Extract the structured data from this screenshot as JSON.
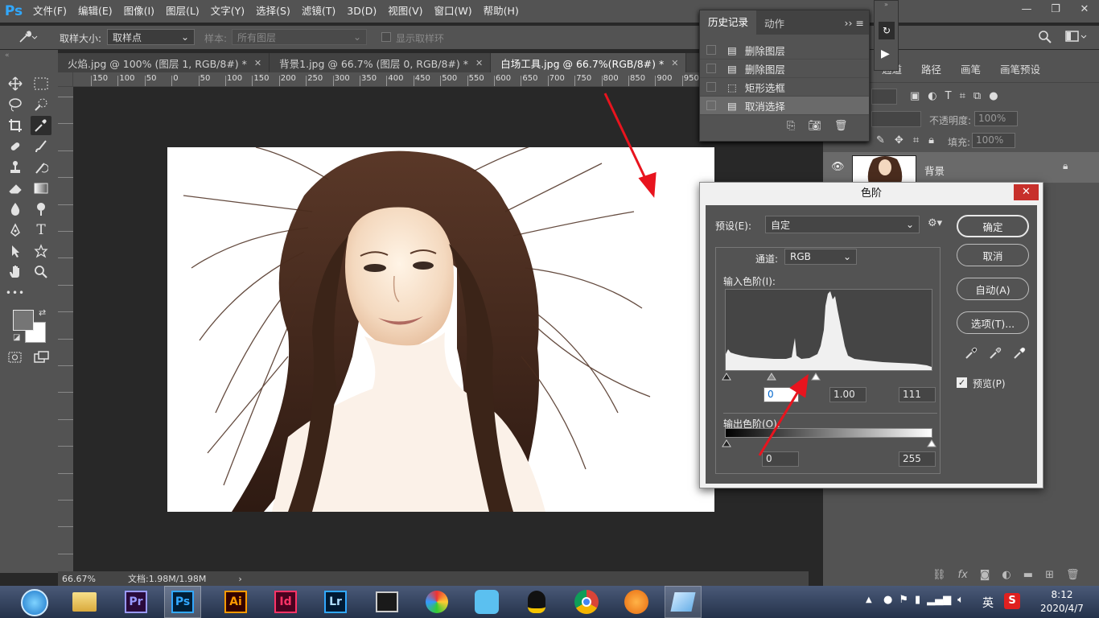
{
  "app": {
    "logo": "Ps"
  },
  "menu": [
    "文件(F)",
    "编辑(E)",
    "图像(I)",
    "图层(L)",
    "文字(Y)",
    "选择(S)",
    "滤镜(T)",
    "3D(D)",
    "视图(V)",
    "窗口(W)",
    "帮助(H)"
  ],
  "options_bar": {
    "sample_size_label": "取样大小:",
    "sample_size_value": "取样点",
    "sample_label": "样本:",
    "sample_value": "所有图层",
    "show_ring_label": "显示取样环"
  },
  "doc_tabs": [
    {
      "label": "火焰.jpg @ 100% (图层 1, RGB/8#) *"
    },
    {
      "label": "背景1.jpg @ 66.7% (图层 0, RGB/8#) *"
    },
    {
      "label": "白场工具.jpg @ 66.7%(RGB/8#) *"
    }
  ],
  "ruler_ticks": [
    "150",
    "100",
    "50",
    "0",
    "50",
    "100",
    "150",
    "200",
    "250",
    "300",
    "350",
    "400",
    "450",
    "500",
    "550",
    "600",
    "650",
    "700",
    "750",
    "800",
    "850",
    "900",
    "950"
  ],
  "status": {
    "zoom": "66.67%",
    "doc_info": "文档:1.98M/1.98M"
  },
  "history_panel": {
    "tab_history": "历史记录",
    "tab_actions": "动作",
    "items": [
      {
        "label": "删除图层"
      },
      {
        "label": "删除图层"
      },
      {
        "label": "矩形选框"
      },
      {
        "label": "取消选择"
      }
    ]
  },
  "right_panel": {
    "tabs": [
      "通道",
      "路径",
      "画笔",
      "画笔预设"
    ],
    "opacity_label": "不透明度:",
    "opacity_value": "100%",
    "fill_label": "填充:",
    "fill_value": "100%",
    "layer_name": "背景"
  },
  "levels_dialog": {
    "title": "色阶",
    "preset_label": "预设(E):",
    "preset_value": "自定",
    "channel_label": "通道:",
    "channel_value": "RGB",
    "input_levels_label": "输入色阶(I):",
    "input_black": "0",
    "input_gamma": "1.00",
    "input_white": "111",
    "output_levels_label": "输出色阶(O):",
    "output_black": "0",
    "output_white": "255",
    "btn_ok": "确定",
    "btn_cancel": "取消",
    "btn_auto": "自动(A)",
    "btn_options": "选项(T)...",
    "preview_label": "预览(P)"
  },
  "taskbar": {
    "apps": [
      "Pr",
      "Ps",
      "Ai",
      "Id",
      "Lr"
    ],
    "ime": "英",
    "time": "8:12",
    "date": "2020/4/7"
  },
  "colors": {
    "ps_blue": "#31a8ff",
    "pr_purple": "#9999ff",
    "ai_orange": "#ff9a00",
    "id_pink": "#ff3366",
    "lr_blue": "#31a8ff",
    "arrow_red": "#e8141e"
  }
}
